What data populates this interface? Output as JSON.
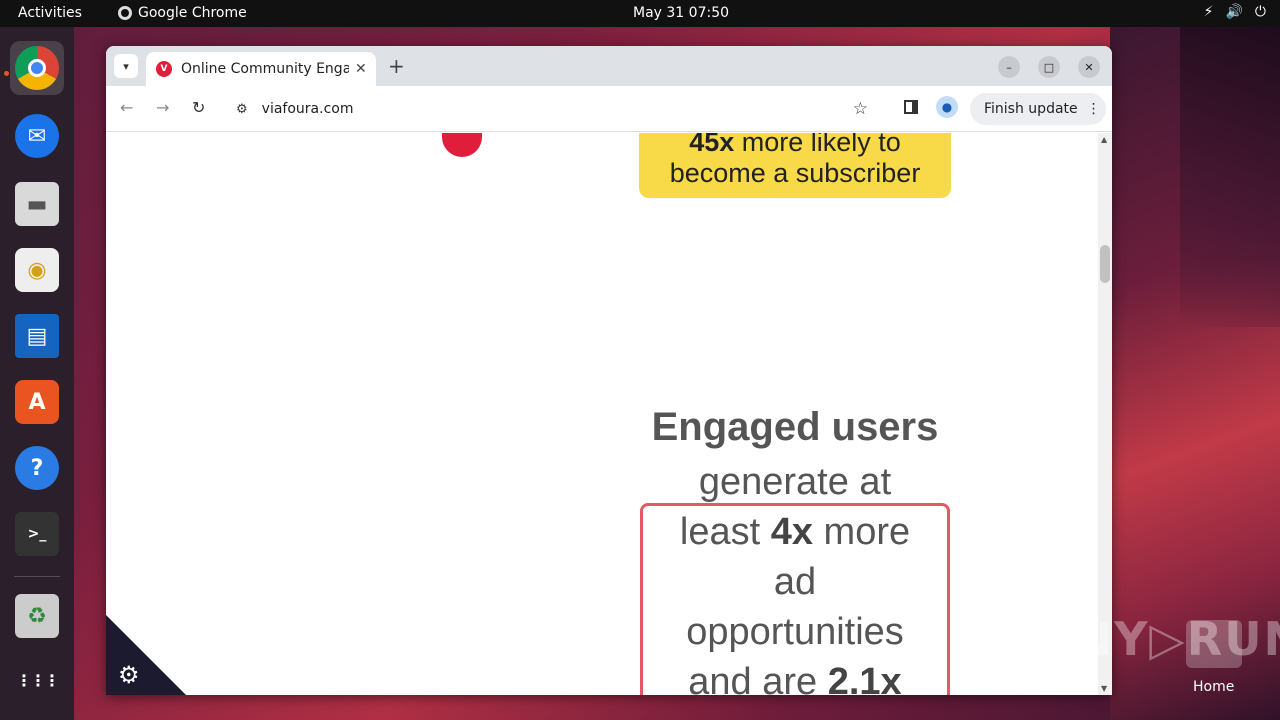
{
  "topbar": {
    "activities": "Activities",
    "app_name": "Google Chrome",
    "clock": "May 31  07:50",
    "tray_network": "⚡",
    "tray_volume": "🔊",
    "tray_power": "⏻"
  },
  "dock": {
    "items": [
      {
        "name": "chrome",
        "glyph": ""
      },
      {
        "name": "thunderbird",
        "glyph": "✉"
      },
      {
        "name": "files",
        "glyph": "▬"
      },
      {
        "name": "rhythmbox",
        "glyph": "◉"
      },
      {
        "name": "writer",
        "glyph": "▤"
      },
      {
        "name": "app-center",
        "glyph": "A"
      },
      {
        "name": "help",
        "glyph": "?"
      },
      {
        "name": "terminal",
        "glyph": ">_"
      },
      {
        "name": "trash",
        "glyph": "♻"
      },
      {
        "name": "app-grid",
        "glyph": "⋮⋮⋮"
      }
    ]
  },
  "browser": {
    "tab_title": "Online Community Engagement",
    "favicon_letter": "V",
    "close_glyph": "✕",
    "newtab_glyph": "+",
    "url": "viafoura.com",
    "update_label": "Finish update",
    "minimize_glyph": "–",
    "maximize_glyph": "□",
    "close_window_glyph": "✕"
  },
  "page": {
    "card_bold": "45x",
    "card_line1_rest": " more likely to",
    "card_line2": "become a subscriber",
    "stat_head": "Engaged users",
    "stat_l1": "generate at",
    "stat_l2_pre": "least ",
    "stat_l2_bold": "4x",
    "stat_l2_post": " more",
    "stat_l3": "ad",
    "stat_l4": "opportunities",
    "stat_l5_pre": "and are ",
    "stat_l5_bold": "2.1x"
  },
  "desktop": {
    "watermark": "ANY▷RUN",
    "home_label": "Home"
  },
  "colors": {
    "brand_red": "#e01e3c",
    "card_yellow": "#f8d948",
    "ubuntu_orange": "#e95420"
  }
}
